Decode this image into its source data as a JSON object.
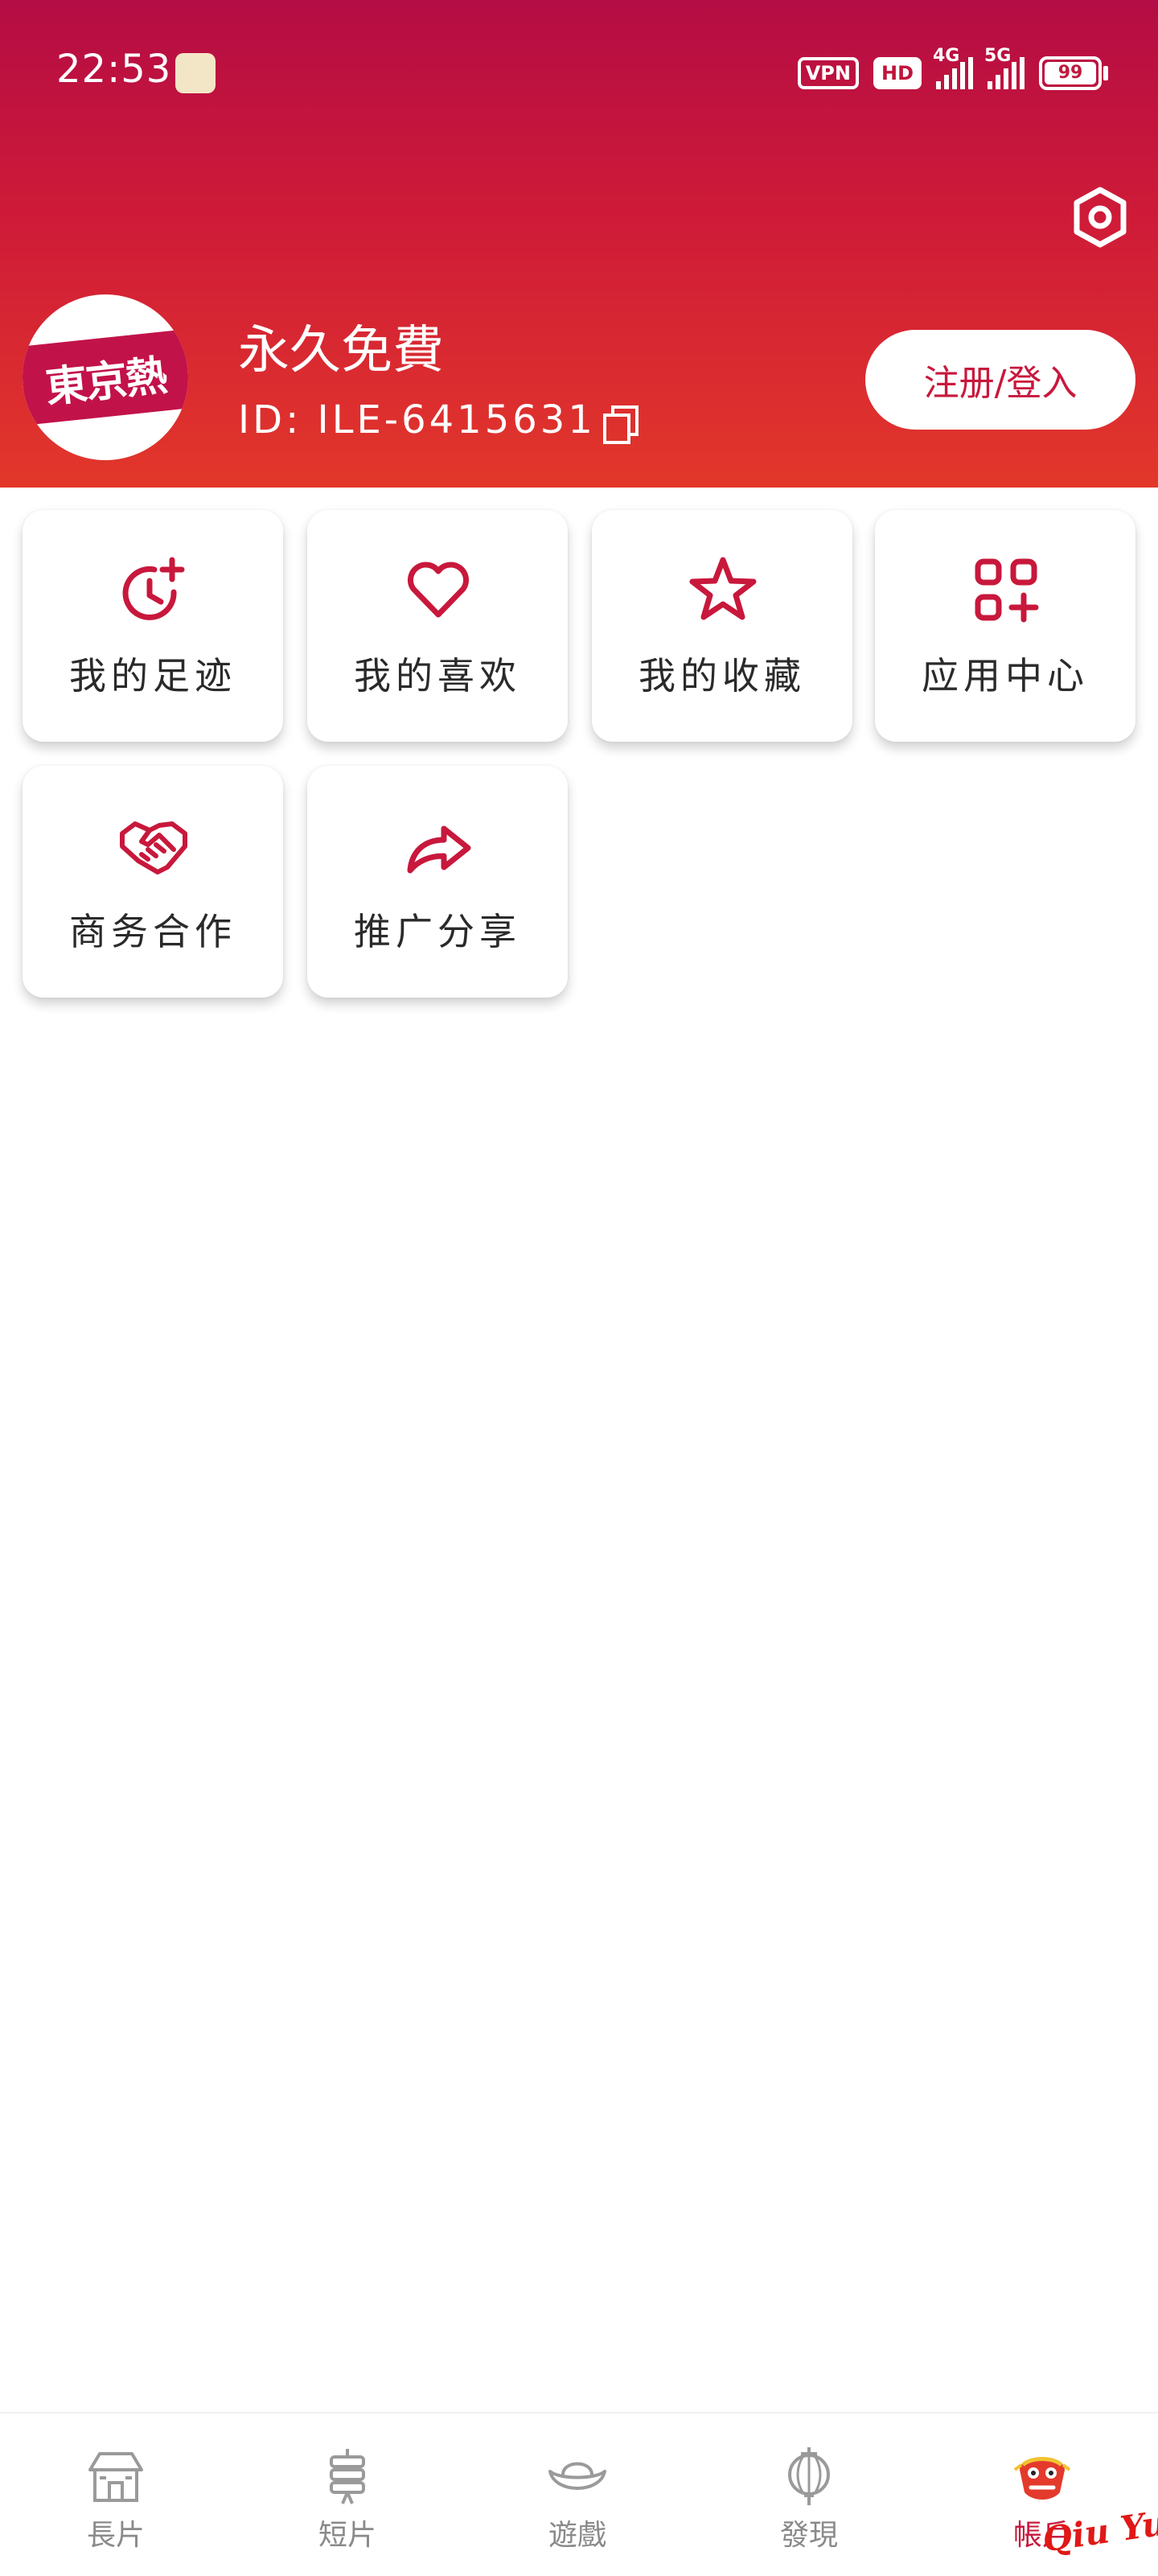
{
  "status_bar": {
    "time": "22:53",
    "vpn": "VPN",
    "hd": "HD",
    "net1": "4G",
    "net2": "5G",
    "battery": "99"
  },
  "profile": {
    "avatar_text": "東京熱",
    "username": "永久免費",
    "id": "ID: ILE-6415631",
    "login_label": "注册/登入"
  },
  "menu": {
    "items": [
      {
        "label": "我的足迹",
        "icon": "history-icon"
      },
      {
        "label": "我的喜欢",
        "icon": "heart-icon"
      },
      {
        "label": "我的收藏",
        "icon": "star-icon"
      },
      {
        "label": "应用中心",
        "icon": "apps-icon"
      },
      {
        "label": "商务合作",
        "icon": "handshake-icon"
      },
      {
        "label": "推广分享",
        "icon": "share-icon"
      }
    ]
  },
  "nav": {
    "items": [
      {
        "label": "長片",
        "icon": "house-icon",
        "active": false
      },
      {
        "label": "短片",
        "icon": "firecracker-icon",
        "active": false
      },
      {
        "label": "遊戲",
        "icon": "ingot-icon",
        "active": false
      },
      {
        "label": "發現",
        "icon": "lantern-icon",
        "active": false
      },
      {
        "label": "帳戶",
        "icon": "lion-dance-icon",
        "active": true
      }
    ]
  },
  "watermark": "Qiu Yue",
  "colors": {
    "accent": "#c8183c",
    "header_top": "#b40c44",
    "header_bottom": "#e2372a"
  }
}
